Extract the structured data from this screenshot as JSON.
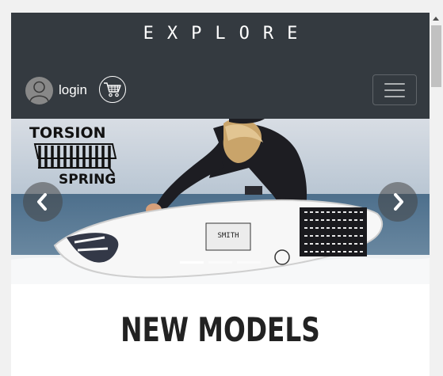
{
  "header": {
    "brand": "EXPLORE",
    "login_label": "login",
    "user_icon": "user-avatar-icon",
    "cart_icon": "shopping-cart-icon",
    "menu_icon": "hamburger-menu-icon"
  },
  "carousel": {
    "logo_text_top": "TORSION",
    "logo_text_bottom": "SPRING",
    "board_text": "SMITH",
    "prev_icon": "chevron-left-icon",
    "next_icon": "chevron-right-icon",
    "active_slide": 1,
    "slide_count": 3
  },
  "main": {
    "section_title": "NEW MODELS"
  },
  "colors": {
    "navbar": "#343a40",
    "page_background": "#ffffff",
    "title_text": "#222222"
  }
}
